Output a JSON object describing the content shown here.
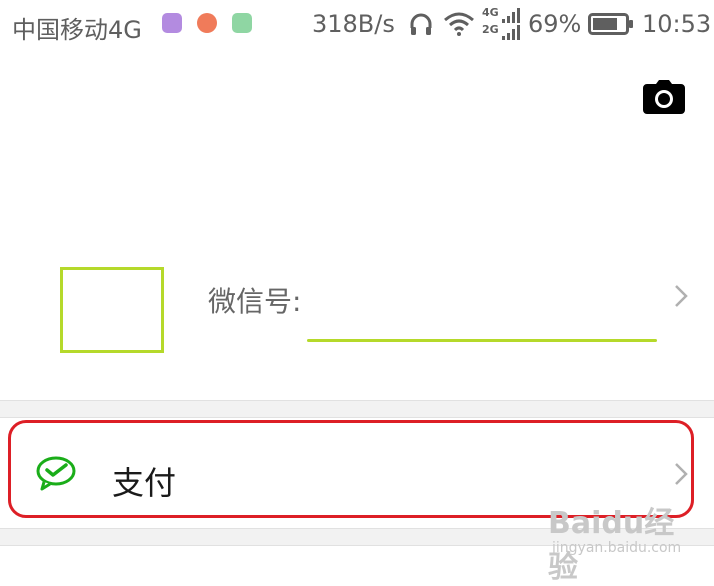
{
  "status_bar": {
    "carrier": "中国移动4G",
    "net_speed": "318B/s",
    "signal_top": "4G",
    "signal_bottom": "2G",
    "battery": "69%",
    "time": "10:53"
  },
  "profile": {
    "wechat_id_label": "微信号:"
  },
  "menu": {
    "pay_label": "支付"
  },
  "icons": {
    "camera": "camera-icon",
    "pay": "wechat-pay-icon",
    "chevron": "chevron-right-icon"
  },
  "colors": {
    "highlight_red": "#dd1f26",
    "annotation_green": "#b5d92a",
    "pay_green": "#1aad19"
  },
  "watermark": {
    "brand": "Baidu经验",
    "url": "jingyan.baidu.com"
  }
}
